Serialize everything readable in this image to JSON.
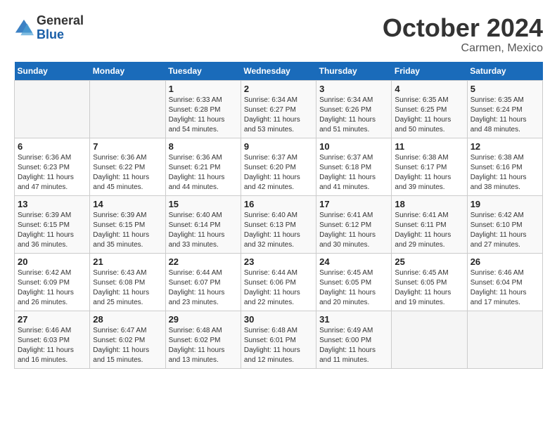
{
  "header": {
    "logo_general": "General",
    "logo_blue": "Blue",
    "month_title": "October 2024",
    "subtitle": "Carmen, Mexico"
  },
  "days_of_week": [
    "Sunday",
    "Monday",
    "Tuesday",
    "Wednesday",
    "Thursday",
    "Friday",
    "Saturday"
  ],
  "weeks": [
    [
      {
        "day": "",
        "info": ""
      },
      {
        "day": "",
        "info": ""
      },
      {
        "day": "1",
        "info": "Sunrise: 6:33 AM\nSunset: 6:28 PM\nDaylight: 11 hours and 54 minutes."
      },
      {
        "day": "2",
        "info": "Sunrise: 6:34 AM\nSunset: 6:27 PM\nDaylight: 11 hours and 53 minutes."
      },
      {
        "day": "3",
        "info": "Sunrise: 6:34 AM\nSunset: 6:26 PM\nDaylight: 11 hours and 51 minutes."
      },
      {
        "day": "4",
        "info": "Sunrise: 6:35 AM\nSunset: 6:25 PM\nDaylight: 11 hours and 50 minutes."
      },
      {
        "day": "5",
        "info": "Sunrise: 6:35 AM\nSunset: 6:24 PM\nDaylight: 11 hours and 48 minutes."
      }
    ],
    [
      {
        "day": "6",
        "info": "Sunrise: 6:36 AM\nSunset: 6:23 PM\nDaylight: 11 hours and 47 minutes."
      },
      {
        "day": "7",
        "info": "Sunrise: 6:36 AM\nSunset: 6:22 PM\nDaylight: 11 hours and 45 minutes."
      },
      {
        "day": "8",
        "info": "Sunrise: 6:36 AM\nSunset: 6:21 PM\nDaylight: 11 hours and 44 minutes."
      },
      {
        "day": "9",
        "info": "Sunrise: 6:37 AM\nSunset: 6:20 PM\nDaylight: 11 hours and 42 minutes."
      },
      {
        "day": "10",
        "info": "Sunrise: 6:37 AM\nSunset: 6:18 PM\nDaylight: 11 hours and 41 minutes."
      },
      {
        "day": "11",
        "info": "Sunrise: 6:38 AM\nSunset: 6:17 PM\nDaylight: 11 hours and 39 minutes."
      },
      {
        "day": "12",
        "info": "Sunrise: 6:38 AM\nSunset: 6:16 PM\nDaylight: 11 hours and 38 minutes."
      }
    ],
    [
      {
        "day": "13",
        "info": "Sunrise: 6:39 AM\nSunset: 6:15 PM\nDaylight: 11 hours and 36 minutes."
      },
      {
        "day": "14",
        "info": "Sunrise: 6:39 AM\nSunset: 6:15 PM\nDaylight: 11 hours and 35 minutes."
      },
      {
        "day": "15",
        "info": "Sunrise: 6:40 AM\nSunset: 6:14 PM\nDaylight: 11 hours and 33 minutes."
      },
      {
        "day": "16",
        "info": "Sunrise: 6:40 AM\nSunset: 6:13 PM\nDaylight: 11 hours and 32 minutes."
      },
      {
        "day": "17",
        "info": "Sunrise: 6:41 AM\nSunset: 6:12 PM\nDaylight: 11 hours and 30 minutes."
      },
      {
        "day": "18",
        "info": "Sunrise: 6:41 AM\nSunset: 6:11 PM\nDaylight: 11 hours and 29 minutes."
      },
      {
        "day": "19",
        "info": "Sunrise: 6:42 AM\nSunset: 6:10 PM\nDaylight: 11 hours and 27 minutes."
      }
    ],
    [
      {
        "day": "20",
        "info": "Sunrise: 6:42 AM\nSunset: 6:09 PM\nDaylight: 11 hours and 26 minutes."
      },
      {
        "day": "21",
        "info": "Sunrise: 6:43 AM\nSunset: 6:08 PM\nDaylight: 11 hours and 25 minutes."
      },
      {
        "day": "22",
        "info": "Sunrise: 6:44 AM\nSunset: 6:07 PM\nDaylight: 11 hours and 23 minutes."
      },
      {
        "day": "23",
        "info": "Sunrise: 6:44 AM\nSunset: 6:06 PM\nDaylight: 11 hours and 22 minutes."
      },
      {
        "day": "24",
        "info": "Sunrise: 6:45 AM\nSunset: 6:05 PM\nDaylight: 11 hours and 20 minutes."
      },
      {
        "day": "25",
        "info": "Sunrise: 6:45 AM\nSunset: 6:05 PM\nDaylight: 11 hours and 19 minutes."
      },
      {
        "day": "26",
        "info": "Sunrise: 6:46 AM\nSunset: 6:04 PM\nDaylight: 11 hours and 17 minutes."
      }
    ],
    [
      {
        "day": "27",
        "info": "Sunrise: 6:46 AM\nSunset: 6:03 PM\nDaylight: 11 hours and 16 minutes."
      },
      {
        "day": "28",
        "info": "Sunrise: 6:47 AM\nSunset: 6:02 PM\nDaylight: 11 hours and 15 minutes."
      },
      {
        "day": "29",
        "info": "Sunrise: 6:48 AM\nSunset: 6:02 PM\nDaylight: 11 hours and 13 minutes."
      },
      {
        "day": "30",
        "info": "Sunrise: 6:48 AM\nSunset: 6:01 PM\nDaylight: 11 hours and 12 minutes."
      },
      {
        "day": "31",
        "info": "Sunrise: 6:49 AM\nSunset: 6:00 PM\nDaylight: 11 hours and 11 minutes."
      },
      {
        "day": "",
        "info": ""
      },
      {
        "day": "",
        "info": ""
      }
    ]
  ]
}
